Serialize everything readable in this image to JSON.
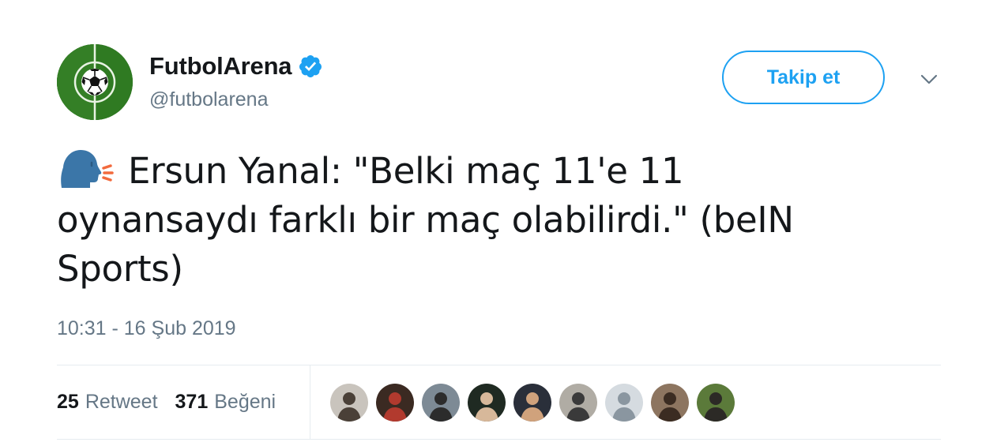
{
  "author": {
    "display_name": "FutbolArena",
    "handle": "@futbolarena",
    "verified": true,
    "avatar_icon": "soccer-ball-field-icon"
  },
  "actions": {
    "follow_label": "Takip et",
    "menu_icon": "chevron-down-icon"
  },
  "tweet": {
    "emoji": "speaking-head-emoji",
    "text": "Ersun Yanal: \"Belki maç 11'e 11 oynansaydı farklı bir maç olabilirdi.\" (beIN Sports)",
    "timestamp": "10:31 - 16 Şub 2019"
  },
  "stats": {
    "retweets": {
      "count": "25",
      "label": "Retweet"
    },
    "likes": {
      "count": "371",
      "label": "Beğeni"
    }
  },
  "likers": [
    {
      "bg": "#c9c4bd",
      "fg": "#4a4038"
    },
    {
      "bg": "#3b2a22",
      "fg": "#b23a2e"
    },
    {
      "bg": "#7d8a95",
      "fg": "#2c2c2c"
    },
    {
      "bg": "#1f2a22",
      "fg": "#d7b89a"
    },
    {
      "bg": "#2a2f3a",
      "fg": "#d0a27c"
    },
    {
      "bg": "#b0aca4",
      "fg": "#3a3a3a"
    },
    {
      "bg": "#d5dbe0",
      "fg": "#8a96a0"
    },
    {
      "bg": "#8d7560",
      "fg": "#3b2c22"
    },
    {
      "bg": "#5b7a3a",
      "fg": "#2c2a26"
    }
  ],
  "colors": {
    "accent": "#1da1f2",
    "text": "#14171a",
    "muted": "#657786",
    "divider": "#e6ecf0"
  }
}
